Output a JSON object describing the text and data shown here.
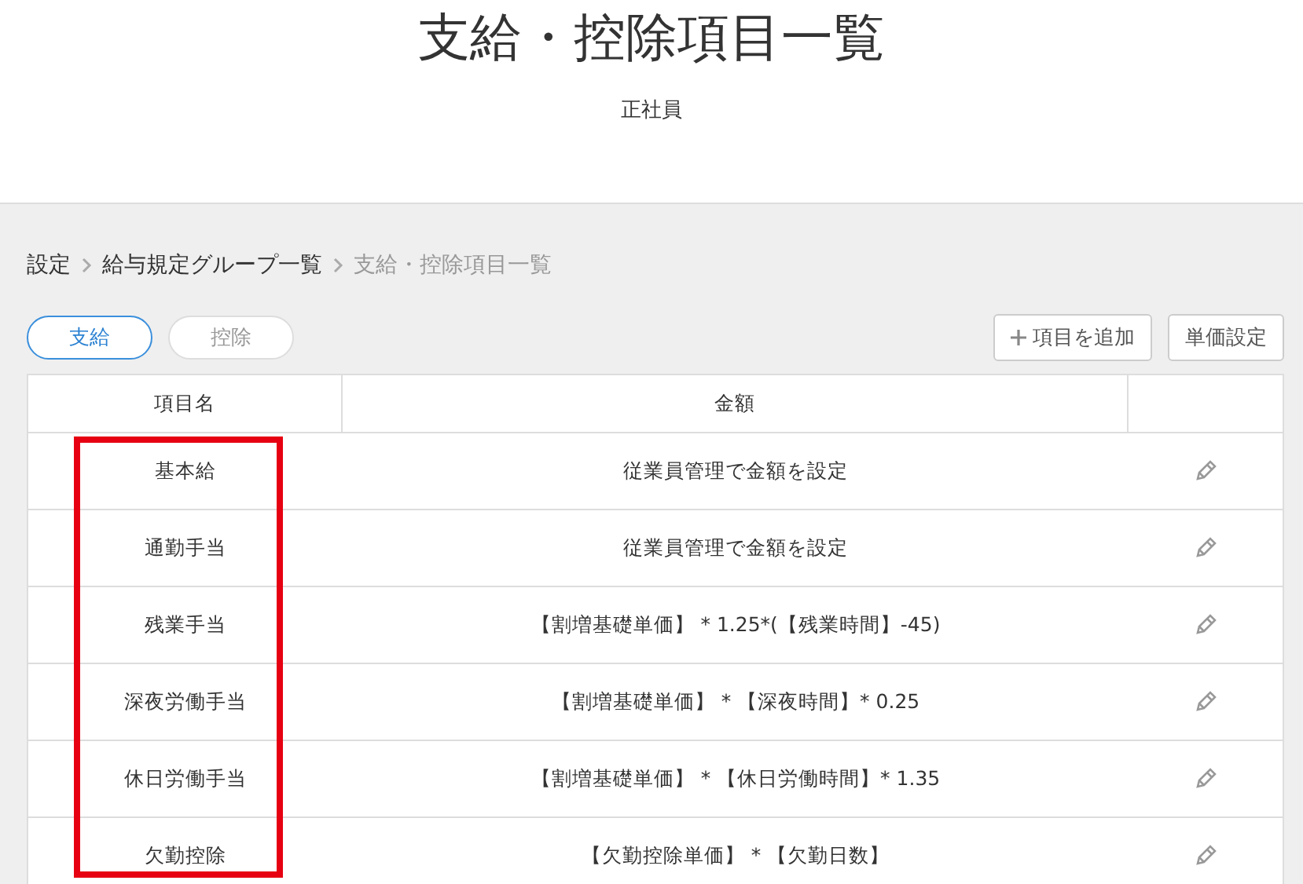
{
  "header": {
    "title": "支給・控除項目一覧",
    "subtitle": "正社員"
  },
  "breadcrumb": [
    {
      "label": "設定",
      "current": false
    },
    {
      "label": "給与規定グループ一覧",
      "current": false
    },
    {
      "label": "支給・控除項目一覧",
      "current": true
    }
  ],
  "tabs": [
    {
      "label": "支給",
      "selected": true
    },
    {
      "label": "控除",
      "selected": false
    }
  ],
  "buttons": [
    {
      "label": "項目を追加",
      "kind": "add"
    },
    {
      "label": "単価設定",
      "kind": "plain"
    }
  ],
  "table": {
    "columns": [
      "項目名",
      "金額"
    ],
    "name_column_highlighted": true,
    "rows": [
      {
        "name": "基本給",
        "amount": "従業員管理で金額を設定"
      },
      {
        "name": "通勤手当",
        "amount": "従業員管理で金額を設定"
      },
      {
        "name": "残業手当",
        "amount": "【割増基礎単価】 * 1.25*(【残業時間】-45)"
      },
      {
        "name": "深夜労働手当",
        "amount": "【割増基礎単価】 * 【深夜時間】* 0.25"
      },
      {
        "name": "休日労働手当",
        "amount": "【割増基礎単価】 * 【休日労働時間】* 1.35"
      },
      {
        "name": "欠勤控除",
        "amount": "【欠勤控除単価】 * 【欠勤日数】"
      }
    ]
  }
}
